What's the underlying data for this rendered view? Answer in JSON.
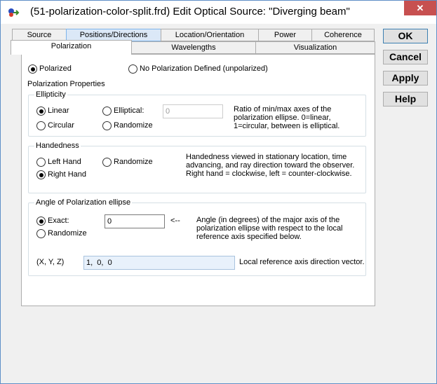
{
  "window": {
    "title": "(51-polarization-color-split.frd) Edit Optical Source: \"Diverging beam\"",
    "close_label": "✕"
  },
  "tabs_row1": [
    "Source",
    "Positions/Directions",
    "Location/Orientation",
    "Power",
    "Coherence"
  ],
  "tabs_row2": [
    "Polarization",
    "Wavelengths",
    "Visualization"
  ],
  "buttons": {
    "ok": "OK",
    "cancel": "Cancel",
    "apply": "Apply",
    "help": "Help"
  },
  "polarization": {
    "polarized_label": "Polarized",
    "none_label": "No Polarization Defined (unpolarized)",
    "properties_label": "Polarization Properties"
  },
  "ellipticity": {
    "title": "Ellipticity",
    "linear": "Linear",
    "elliptical": "Elliptical:",
    "circular": "Circular",
    "randomize": "Randomize",
    "value": "0",
    "description": "Ratio of min/max axes of the polarization ellipse.  0=linear, 1=circular, between is elliptical."
  },
  "handedness": {
    "title": "Handedness",
    "left": "Left Hand",
    "randomize": "Randomize",
    "right": "Right Hand",
    "description": "Handedness viewed in stationary location, time advancing, and ray direction toward the observer. Right hand = clockwise,  left = counter-clockwise."
  },
  "angle": {
    "title": "Angle of Polarization ellipse",
    "exact": "Exact:",
    "randomize": "Randomize",
    "value": "0",
    "arrow": "<--",
    "description": "Angle (in degrees) of the major axis of the polarization ellipse with respect to the local reference axis specified below.",
    "xyz_label": "(X, Y, Z)",
    "xyz_value": "1,  0,  0",
    "xyz_description": "Local reference axis direction vector."
  },
  "colors": {
    "accent": "#7eb4ea",
    "close": "#c75050",
    "group_border": "#d5dfe5"
  }
}
